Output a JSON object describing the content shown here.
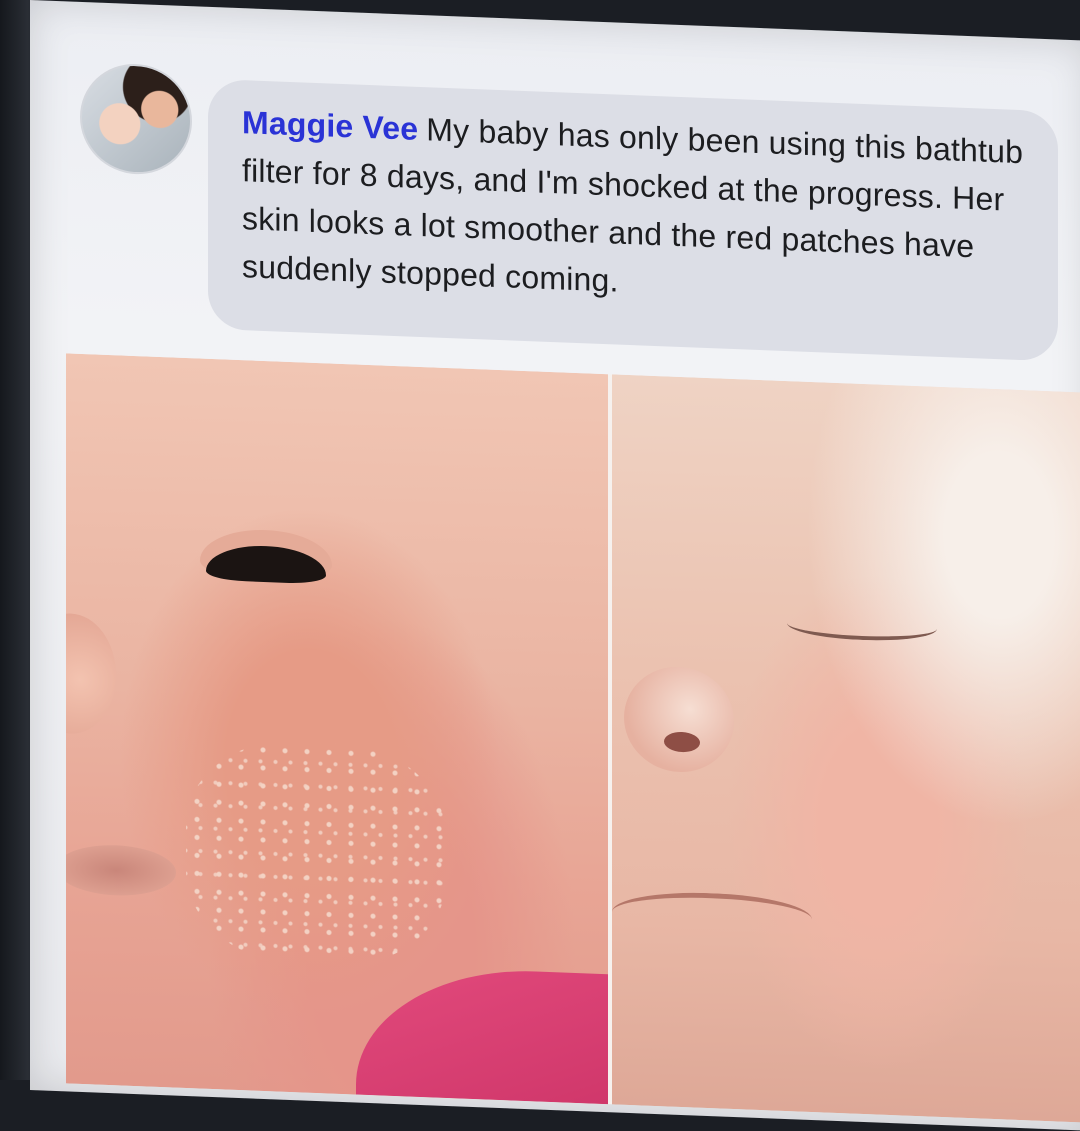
{
  "post": {
    "author": "Maggie Vee",
    "comment": "My baby has only been using this bathtub filter for 8 days, and I'm shocked at the progress. Her skin looks a lot smoother and the red patches have suddenly stopped coming."
  },
  "icons": {
    "avatar": "profile-photo"
  },
  "colors": {
    "author_link": "#2a33d6",
    "bubble_bg": "#dcdee6",
    "text": "#1c1d20"
  }
}
